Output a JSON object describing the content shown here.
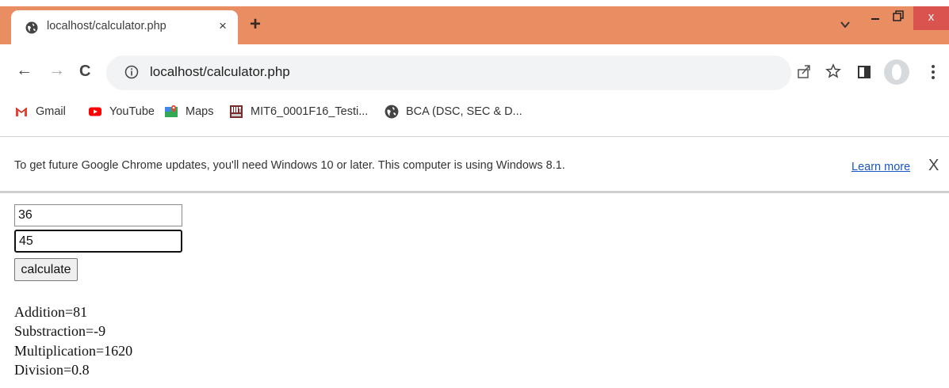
{
  "browser": {
    "tab": {
      "title": "localhost/calculator.php",
      "close": "×"
    },
    "new_tab": "+",
    "window_close": "x",
    "address": {
      "url": "localhost/calculator.php"
    },
    "nav": {
      "back": "←",
      "forward": "→",
      "reload": "C"
    },
    "bookmarks": [
      {
        "label": "Gmail",
        "icon": "gmail-icon"
      },
      {
        "label": "YouTube",
        "icon": "youtube-icon"
      },
      {
        "label": "Maps",
        "icon": "maps-icon"
      },
      {
        "label": "MIT6_0001F16_Testi...",
        "icon": "mit-ocw-icon"
      },
      {
        "label": "BCA (DSC, SEC & D...",
        "icon": "globe-icon"
      }
    ],
    "infobar": {
      "message": "To get future Google Chrome updates, you'll need Windows 10 or later. This computer is using Windows 8.1.",
      "link": "Learn more",
      "close": "X"
    }
  },
  "page": {
    "form": {
      "input1": "36",
      "input2": "45",
      "button_label": "calculate"
    },
    "results": [
      "Addition=81",
      "Substraction=-9",
      "Multiplication=1620",
      "Division=0.8"
    ]
  },
  "colors": {
    "tabstrip": "#e98d62",
    "window_close": "#d9534f",
    "link": "#1a55c5"
  }
}
